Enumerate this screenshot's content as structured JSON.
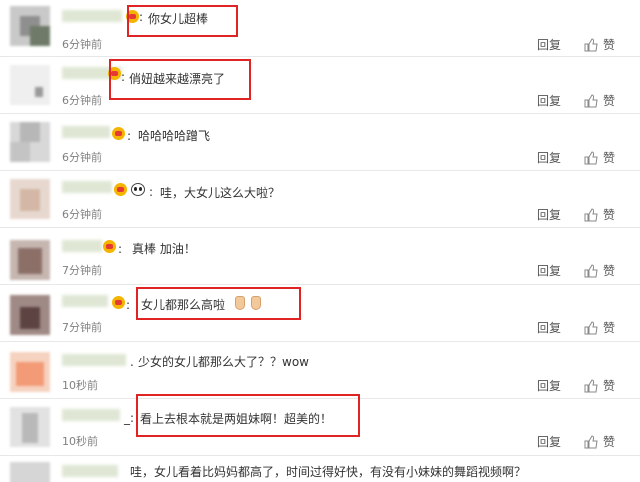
{
  "comments": [
    {
      "text": "你女儿超棒",
      "time": "6分钟前",
      "reply": "回复",
      "like": "赞"
    },
    {
      "text": "俏妞越来越漂亮了",
      "time": "6分钟前",
      "reply": "回复",
      "like": "赞"
    },
    {
      "text": "哈哈哈哈蹭飞",
      "time": "6分钟前",
      "reply": "回复",
      "like": "赞"
    },
    {
      "text": "哇，大女儿这么大啦？",
      "time": "6分钟前",
      "reply": "回复",
      "like": "赞"
    },
    {
      "text": "真棒 加油！",
      "time": "7分钟前",
      "reply": "回复",
      "like": "赞"
    },
    {
      "text": "女儿都那么高啦",
      "time": "7分钟前",
      "reply": "回复",
      "like": "赞"
    },
    {
      "text": "少女的女儿都那么大了？？wow",
      "time": "10秒前",
      "reply": "回复",
      "like": "赞"
    },
    {
      "text": "看上去根本就是两姐妹啊！超美的！",
      "time": "10秒前",
      "reply": "回复",
      "like": "赞"
    },
    {
      "text": "哇，女儿看着比妈妈都高了，时间过得好快，有没有小妹妹的舞蹈视频啊？",
      "time": "",
      "reply": "",
      "like": ""
    }
  ],
  "colors": {
    "highlight": "#e02424",
    "meta": "#808080",
    "separator": "#e8e8e8"
  },
  "icons": {
    "like": "thumbs-up-icon",
    "vip": "vip-badge-icon",
    "panda": "panda-emoji-icon",
    "feet": "feet-emoji-icon"
  }
}
